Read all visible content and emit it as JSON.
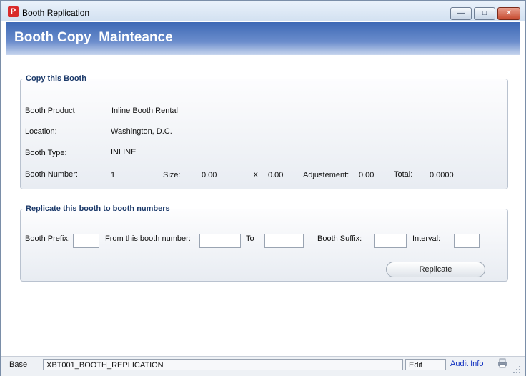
{
  "window": {
    "title": "Booth Replication",
    "app_icon_glyph": "P",
    "minimize": "—",
    "maximize": "□",
    "close": "✕"
  },
  "header": {
    "title": "Booth Copy  Mainteance"
  },
  "copy_section": {
    "legend": "Copy this Booth",
    "product_label": "Booth Product",
    "product_value": "Inline Booth Rental",
    "location_label": "Location:",
    "location_value": "Washington, D.C.",
    "type_label": "Booth Type:",
    "type_value": "INLINE",
    "number_label": "Booth Number:",
    "number_value": "1",
    "size_label": "Size:",
    "size_value": "0.00",
    "x_label": "X",
    "x_value": "0.00",
    "adjustment_label": "Adjustement:",
    "adjustment_value": "0.00",
    "total_label": "Total:",
    "total_value": "0.0000"
  },
  "replicate_section": {
    "legend": "Replicate this booth to booth numbers",
    "prefix_label": "Booth Prefix:",
    "prefix_value": "",
    "from_label": "From this booth number:",
    "from_value": "",
    "to_label": "To",
    "to_value": "",
    "suffix_label": "Booth Suffix:",
    "suffix_value": "",
    "interval_label": "Interval:",
    "interval_value": "",
    "replicate_button": "Replicate"
  },
  "statusbar": {
    "base_label": "Base",
    "form_id": "XBT001_BOOTH_REPLICATION",
    "mode": "Edit",
    "audit_link": "Audit Info",
    "icon": "printer-icon",
    "grip": "size-grip-icon"
  },
  "colors": {
    "header_start": "#3d68b5",
    "legend_text": "#1c3a6a",
    "link": "#1030c0",
    "close_button": "#c64a30"
  }
}
